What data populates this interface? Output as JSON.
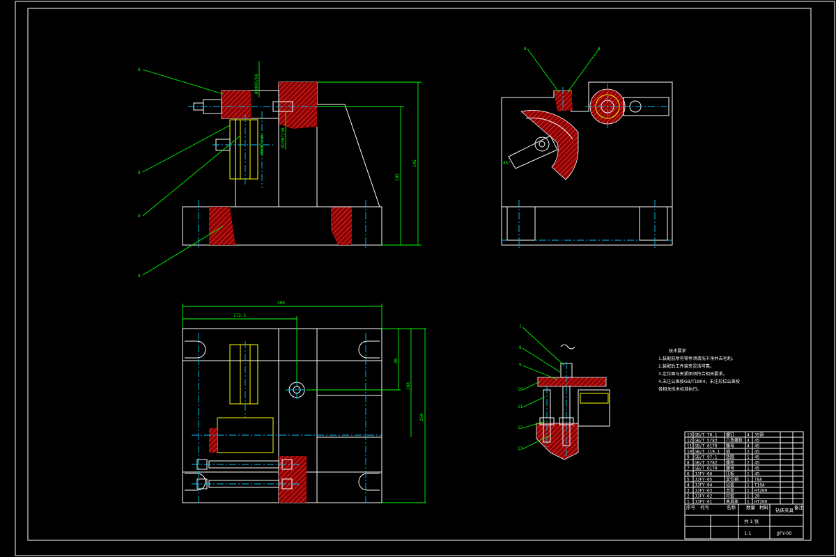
{
  "drawing": {
    "balloons": [
      "8",
      "8",
      "8",
      "8",
      "8",
      "8",
      "7",
      "8",
      "9",
      "10",
      "11",
      "12",
      "13"
    ],
    "dimensions": {
      "front_overall_height": "145",
      "front_inner_height": "105",
      "top_overall_width": "300",
      "top_offset_width": "172.5",
      "top_depth_90": "90",
      "top_depth_160": "160",
      "top_depth_250": "250",
      "fit_1": "Ø30H7/k6",
      "fit_2": "Ø25H7/n6",
      "fit_3": "Ø30H7/n6",
      "angle_note": "45°"
    },
    "notes_title": "技术要求",
    "notes": [
      "1.装配前所有零件须清洗干净并去毛刺。",
      "2.装配后工件装夹灵活可靠。",
      "3.定位面与夹紧面须符合相关要求。",
      "4.未注公差按GB/T1804，未注形位公差按",
      "各相关技术标准执行。"
    ]
  },
  "bom": {
    "rows": [
      {
        "no": "13",
        "code": "GB/T 70.1",
        "name": "螺钉",
        "qty": "4",
        "mat": "35钢"
      },
      {
        "no": "12",
        "code": "GB/T 5783",
        "name": "六角螺栓",
        "qty": "4",
        "mat": "45"
      },
      {
        "no": "11",
        "code": "GB/T 6170",
        "name": "螺母",
        "qty": "4",
        "mat": "45"
      },
      {
        "no": "10",
        "code": "GB/T 119.1",
        "name": "销",
        "qty": "2",
        "mat": "45"
      },
      {
        "no": "9",
        "code": "GB/T 97.1",
        "name": "垫圈",
        "qty": "1",
        "mat": "45"
      },
      {
        "no": "8",
        "code": "GB/T 5782",
        "name": "螺栓",
        "qty": "2",
        "mat": "45"
      },
      {
        "no": "7",
        "code": "GB/T 6170",
        "name": "螺母",
        "qty": "1",
        "mat": "45"
      },
      {
        "no": "6",
        "code": "JJFY-06",
        "name": "压板",
        "qty": "1",
        "mat": "45"
      },
      {
        "no": "5",
        "code": "JJFY-05",
        "name": "定位销",
        "qty": "1",
        "mat": "T8A"
      },
      {
        "no": "4",
        "code": "JJFY-04",
        "name": "钻套",
        "qty": "1",
        "mat": "T10A"
      },
      {
        "no": "3",
        "code": "JJFY-03",
        "name": "支架",
        "qty": "1",
        "mat": "HT200"
      },
      {
        "no": "2",
        "code": "JJFY-02",
        "name": "衬套",
        "qty": "1",
        "mat": "20"
      },
      {
        "no": "1",
        "code": "JJFY-01",
        "name": "夹具体",
        "qty": "1",
        "mat": "HT200"
      }
    ],
    "header": {
      "no": "序号",
      "code": "代号",
      "name": "名称",
      "qty": "数量",
      "mat": "材料",
      "note": "备注"
    }
  },
  "title_block": {
    "title": "钻床夹具",
    "drawing_no": "JJFY-00",
    "scale": "1:1",
    "sheet": "共 1 张"
  }
}
